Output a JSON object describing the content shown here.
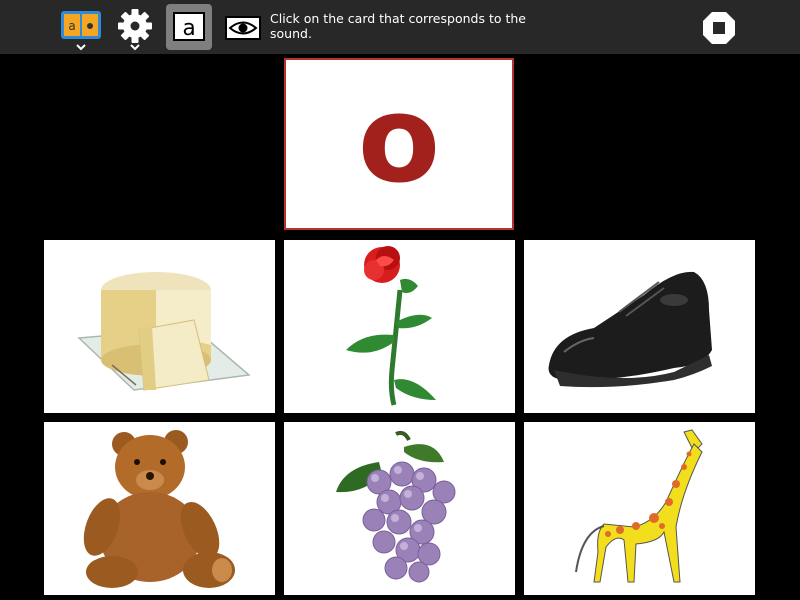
{
  "toolbar": {
    "buttons": [
      {
        "name": "activity-icon"
      },
      {
        "name": "gear-icon"
      },
      {
        "name": "letter-a-icon",
        "label": "a",
        "active": true
      },
      {
        "name": "eye-icon"
      },
      {
        "name": "stop-icon"
      }
    ],
    "instruction": "Click on the card that corresponds to the sound."
  },
  "target_card": {
    "letter": "o",
    "color": "#a3211c"
  },
  "cards": [
    {
      "name": "card-cheese",
      "picture": "cheese"
    },
    {
      "name": "card-rose",
      "picture": "rose"
    },
    {
      "name": "card-shoe",
      "picture": "shoe"
    },
    {
      "name": "card-teddy-bear",
      "picture": "teddy bear"
    },
    {
      "name": "card-grapes",
      "picture": "grapes"
    },
    {
      "name": "card-giraffe",
      "picture": "giraffe"
    }
  ]
}
